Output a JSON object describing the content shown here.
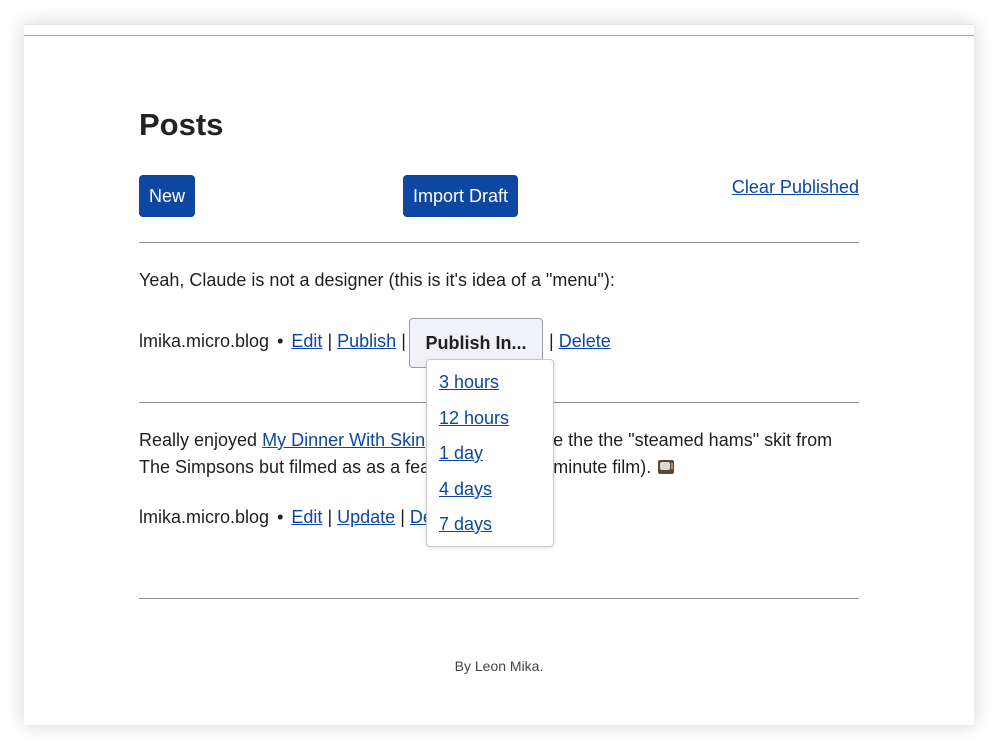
{
  "page": {
    "title": "Posts"
  },
  "toolbar": {
    "new_label": "New",
    "import_label": "Import Draft",
    "clear_label": "Clear Published"
  },
  "posts": [
    {
      "text": "Yeah, Claude is not a designer (this is it's idea of a \"menu\"):",
      "site": "lmika.micro.blog",
      "dot": "•",
      "actions": {
        "edit": "Edit",
        "publish": "Publish",
        "publish_in": "Publish In...",
        "delete": "Delete"
      },
      "separator": "|"
    },
    {
      "text_before": "Really enjoyed ",
      "link_text": "My Dinner With Skin",
      "text_hidden_part": "ner. Basically like the",
      "text_after": "the \"steamed hams\" skit from The Simpsons but filmed as as a feature",
      "text_after2": "ell, a 45 minute film).",
      "icon": "television-icon",
      "site": "lmika.micro.blog",
      "dot": "•",
      "actions": {
        "edit": "Edit",
        "update": "Update",
        "delete_partial": "De"
      },
      "separator": "|"
    }
  ],
  "publish_menu": {
    "options": [
      "3 hours",
      "12 hours",
      "1 day",
      "4 days",
      "7 days"
    ]
  },
  "footer": {
    "text": "By Leon Mika."
  },
  "colors": {
    "accent": "#0d47a1",
    "rule": "#8f8f8f"
  }
}
